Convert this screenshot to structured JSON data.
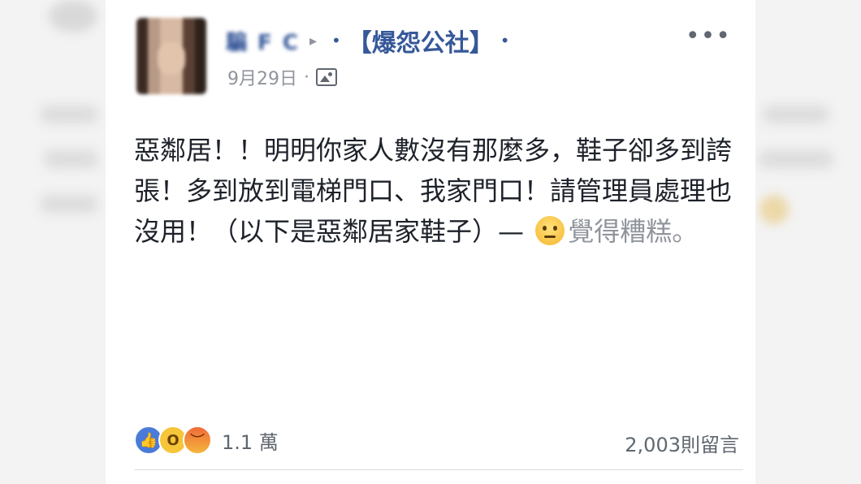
{
  "post": {
    "author_name": "騙 F C",
    "separator_arrow": "▸",
    "group_name": "【爆怨公社】",
    "group_dot": "•",
    "date": "9月29日",
    "meta_sep": "·",
    "text": "惡鄰居！！明明你家人數沒有那麼多，鞋子卻多到誇張！多到放到電梯門口、我家門口！請管理員處理也沒用！（以下是惡鄰居家鞋子）— ",
    "feeling": "覺得糟糕。",
    "more_label": "•••"
  },
  "reactions": {
    "icons": [
      "like-icon",
      "wow-icon",
      "angry-icon"
    ],
    "like_glyph": "👍",
    "wow_glyph": "O",
    "angry_glyph": "︶",
    "count": "1.1 萬"
  },
  "comments": {
    "count_label": "2,003則留言"
  },
  "colors": {
    "link_blue": "#365899",
    "meta_gray": "#90949c",
    "text_dark": "#1d2129"
  }
}
